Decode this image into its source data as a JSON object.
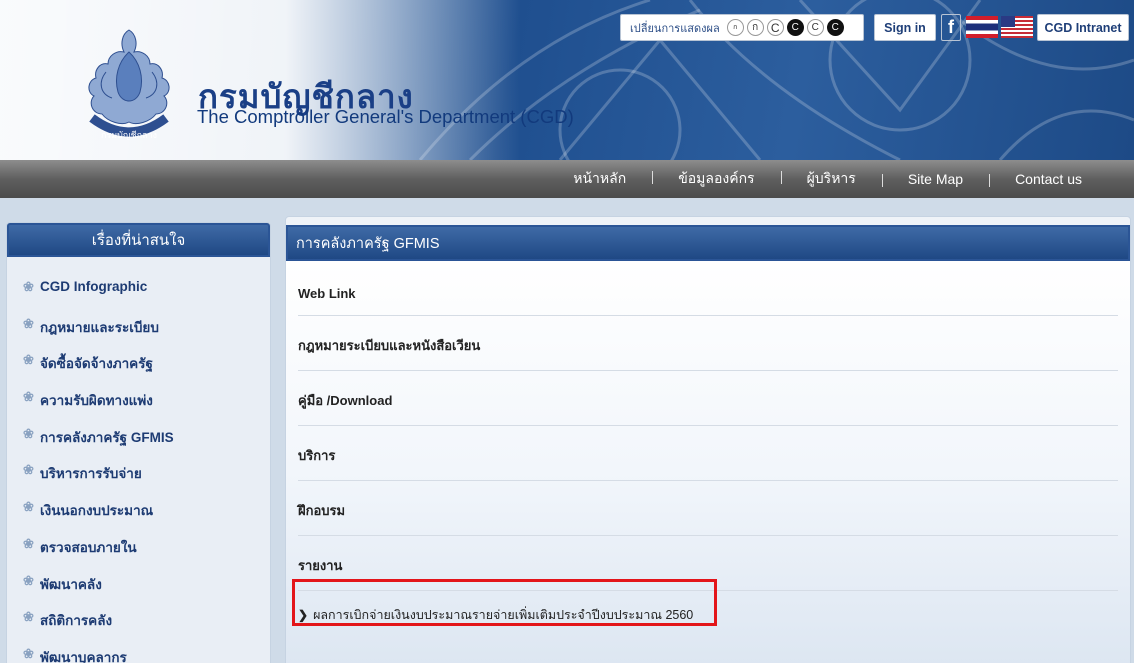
{
  "header": {
    "title_th": "กรมบัญชีกลาง",
    "title_en": "The Comptroller General's Department (CGD)",
    "display_label": "เปลี่ยนการแสดงผล",
    "display_options": [
      "ก",
      "ก",
      "C",
      "C",
      "C"
    ],
    "signin_label": "Sign in",
    "facebook_label": "f",
    "intranet_label": "CGD Intranet",
    "flags": [
      "thai-flag-icon",
      "us-flag-icon"
    ]
  },
  "nav": {
    "items": [
      "หน้าหลัก",
      "ข้อมูลองค์กร",
      "ผู้บริหาร",
      "Site Map",
      "Contact us"
    ]
  },
  "sidebar": {
    "heading": "เรื่องที่น่าสนใจ",
    "items": [
      "CGD Infographic",
      "กฎหมายและระเบียบ",
      "จัดซื้อจัดจ้างภาครัฐ",
      "ความรับผิดทางแพ่ง",
      "การคลังภาครัฐ GFMIS",
      "บริหารการรับจ่าย",
      "เงินนอกงบประมาณ",
      "ตรวจสอบภายใน",
      "พัฒนาคลัง",
      "สถิติการคลัง",
      "พัฒนาบุคลากร"
    ]
  },
  "main": {
    "heading": "การคลังภาครัฐ GFMIS",
    "categories": [
      "Web Link",
      "กฎหมายระเบียบและหนังสือเวียน",
      "คู่มือ /Download",
      "บริการ",
      "ฝึกอบรม",
      "รายงาน"
    ],
    "sub_item": "ผลการเบิกจ่ายเงินงบประมาณรายจ่ายเพิ่มเติมประจำปีงบประมาณ 2560"
  },
  "colors": {
    "highlight": "#e3151a",
    "brand_blue": "#1f4884"
  }
}
